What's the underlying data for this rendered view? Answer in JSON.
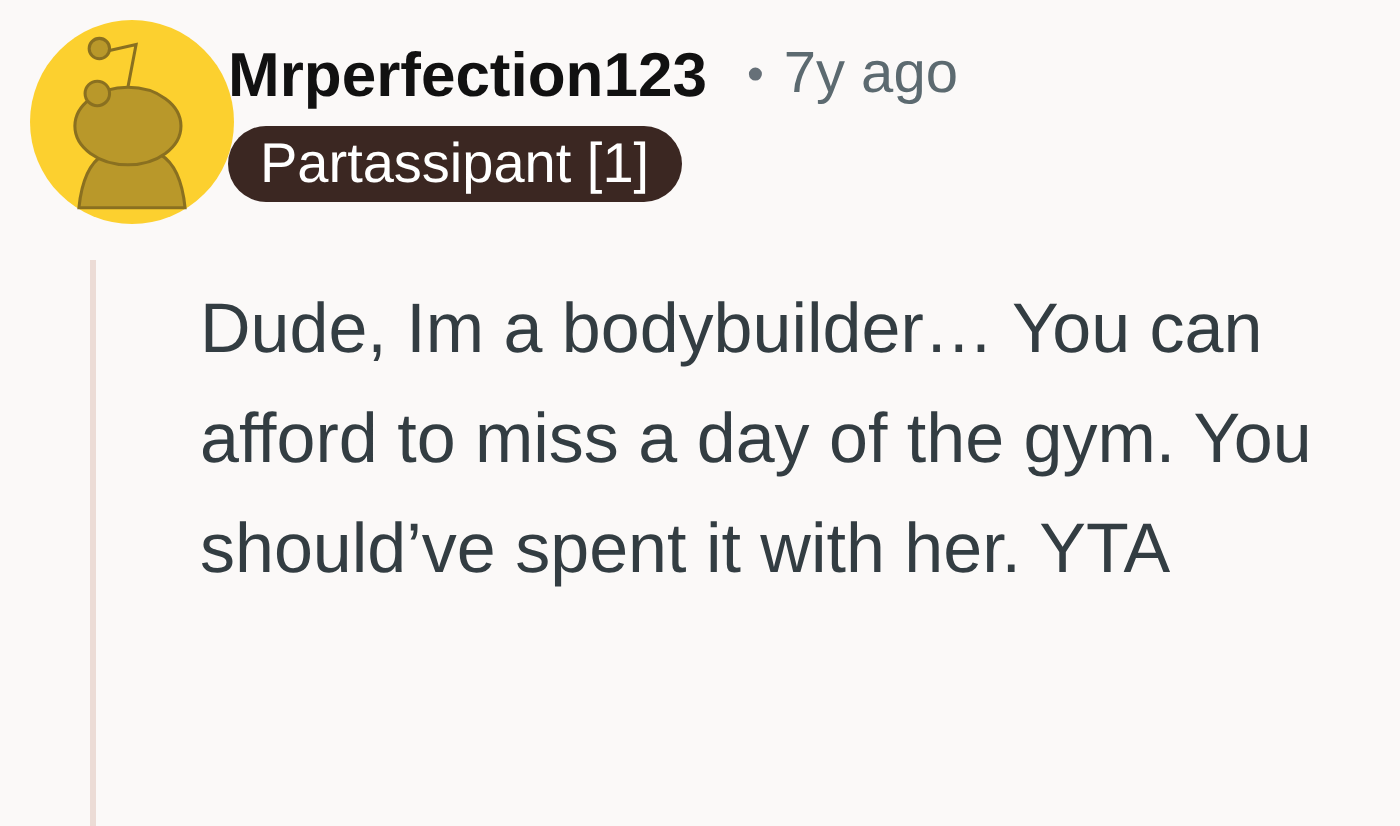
{
  "comment": {
    "author": "Mrperfection123",
    "separator": "•",
    "age": "7y ago",
    "flair": "Partassipant [1]",
    "body": "Dude, Im a bodybuilder… You can afford to miss a day of the gym. You should’ve spent it with her. YTA"
  }
}
